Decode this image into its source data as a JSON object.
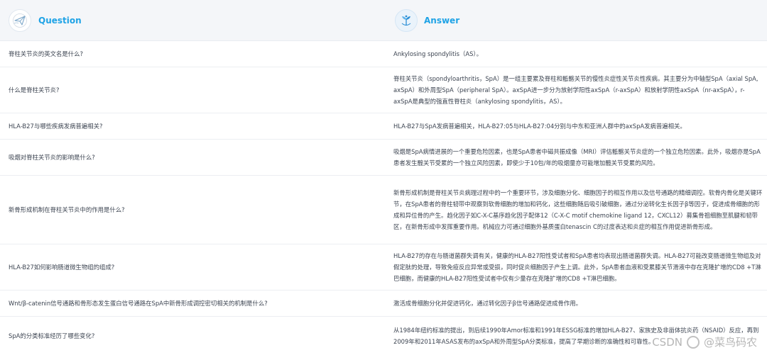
{
  "header": {
    "question_title": "Question",
    "answer_title": "Answer",
    "question_icon": "question-plane-icon",
    "answer_icon": "answer-logo-icon"
  },
  "rows": [
    {
      "question": "脊柱关节炎的英文名是什么?",
      "answer": "Ankylosing spondylitis（AS）。"
    },
    {
      "question": "什么是脊柱关节炎?",
      "answer": "脊柱关节炎（spondyloarthritis，SpA）是一组主要累及脊柱和骶髂关节的慢性炎症性关节炎性疾病。其主要分为中轴型SpA（axial SpA, axSpA）和外周型SpA（peripheral SpA）。axSpA进一步分为放射学阳性axSpA（r-axSpA）和放射学阴性axSpA（nr-axSpA），r-axSpA是典型的强直性脊柱炎（ankylosing spondylitis，AS）。"
    },
    {
      "question": "HLA-B27与哪些疾病发病普遍相关?",
      "answer": "HLA-B27与SpA发病普遍相关，HLA-B27:05与HLA-B27:04分别与中东和亚洲人群中的axSpA发病普遍相关。"
    },
    {
      "question": "吸烟对脊柱关节炎的影响是什么?",
      "answer": "吸烟是SpA病情进展的一个重要危险因素，也是SpA患者中磁共振成像（MRI）评估骶髂关节炎症的一个独立危险因素。此外，吸烟亦是SpA患者发生髋关节受累的一个独立风险因素，即使少于10包/年的吸烟量亦可能增加髋关节受累的风险。"
    },
    {
      "question": "新骨形成机制在脊柱关节炎中的作用是什么?",
      "answer": "新骨形成机制是脊柱关节炎病理过程中的一个重要环节，涉及细胞分化、细胞因子的相互作用以及信号通路的精细调控。软骨内骨化是关键环节，在SpA患者的脊柱韧带中观察到软骨细胞的增加和钙化，这些细胞随后吸引破细胞，通过分泌转化生长因子β等因子，促进成骨细胞的形成和异位骨的产生。趋化因子如C-X-C基序趋化因子配体12（C-X-C motif chemokine ligand 12，CXCL12）募集骨祖细胞至肌腱和韧带区，在新骨形成中发挥重要作用。机械应力可通过细胞外基质蛋白tenascin C的过度表达和炎症的相互作用促进新骨形成。"
    },
    {
      "question": "HLA-B27如何影响肠道微生物组的组成?",
      "answer": "HLA-B27的存在与肠道菌群失调有关，健康的HLA-B27阳性受试者和SpA患者均表现出肠道菌群失调。HLA-B27可能改变肠道微生物组及对假定肽的处理，导致免疫反应异常或受损，同时促炎细胞因子产生上调。此外，SpA患者血液和受累膝关节滑液中存在克隆扩增的CD8 +T淋巴细胞，而健康的HLA-B27阳性受试者中仅有少量存在克隆扩增的CD8 +T淋巴细胞。"
    },
    {
      "question": "Wnt/β-catenin信号通路和骨形态发生蛋白信号通路在SpA中新骨形成调控密切相关的机制是什么?",
      "answer": "激活成骨细胞分化并促进钙化，通过转化因子β信号通路促进成骨作用。"
    },
    {
      "question": "SpA的分类标准经历了哪些变化?",
      "answer": "从1984年纽约标准的提出，到后续1990年Amor标准和1991年ESSG标准的增加HLA-B27、家族史及非甾体抗炎药（NSAID）反应，再到2009年和2011年ASAS发布的axSpA和外周型SpA分类标准，提高了早期诊断的准确性和可靠性。"
    }
  ],
  "watermark": {
    "prefix": "CSDN",
    "handle": "@菜鸟码农"
  }
}
